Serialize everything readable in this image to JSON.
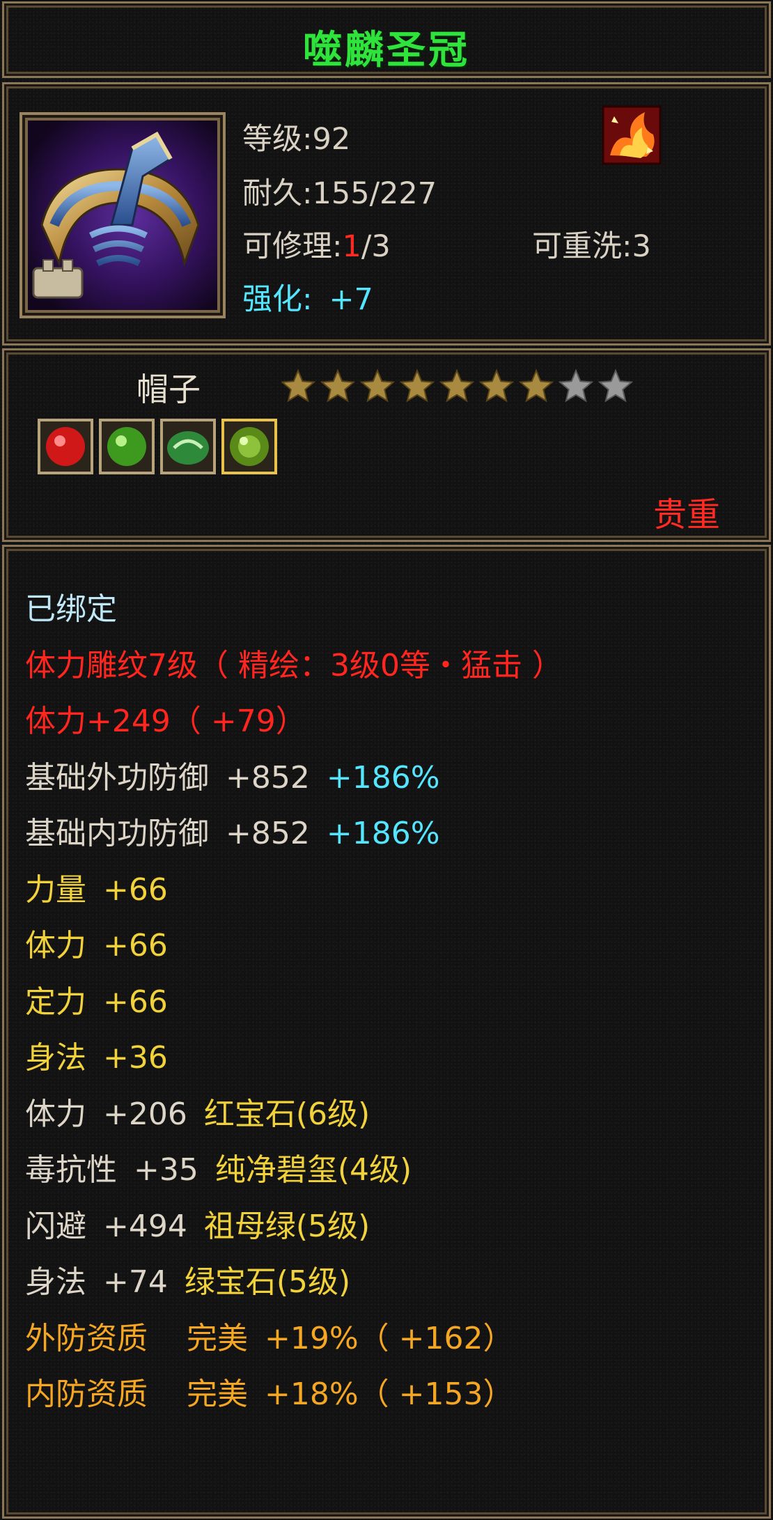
{
  "item": {
    "name": "噬麟圣冠",
    "level_label": "等级",
    "level": "92",
    "durability_label": "耐久",
    "durability": "155/227",
    "repair_label": "可修理",
    "repair_used": "1",
    "repair_total": "/3",
    "rewash_label": "可重洗",
    "rewash": "3",
    "enhance_label": "强化",
    "enhance": "+7",
    "slot": "帽子",
    "stars_filled": 7,
    "stars_total": 9,
    "rarity": "贵重",
    "gems": [
      "ruby-icon",
      "green-gem-icon",
      "jade-icon",
      "emerald-icon"
    ]
  },
  "attributes": {
    "bound": "已绑定",
    "engrave": "体力雕纹7级（ 精绘：3级0等・猛击 ）",
    "stamina_main": "体力+249（ +79）",
    "ext_def_name": "基础外功防御",
    "ext_def_val": "+852",
    "ext_def_pct": "+186%",
    "int_def_name": "基础内功防御",
    "int_def_val": "+852",
    "int_def_pct": "+186%",
    "str_name": "力量",
    "str_val": "+66",
    "sta_name": "体力",
    "sta_val": "+66",
    "foc_name": "定力",
    "foc_val": "+66",
    "agi_name": "身法",
    "agi_val": "+36",
    "gem1_stat": "体力",
    "gem1_val": "+206",
    "gem1_name": "红宝石(6级)",
    "gem2_stat": "毒抗性",
    "gem2_val": "+35",
    "gem2_name": "纯净碧玺(4级)",
    "gem3_stat": "闪避",
    "gem3_val": "+494",
    "gem3_name": "祖母绿(5级)",
    "gem4_stat": "身法",
    "gem4_val": "+74",
    "gem4_name": "绿宝石(5级)",
    "q1_name": "外防资质",
    "q1_grade": "完美",
    "q1_val": "+19%（ +162）",
    "q2_name": "内防资质",
    "q2_grade": "完美",
    "q2_val": "+18%（ +153）"
  },
  "colors": {
    "title": "#2fe33c",
    "red": "#ff2620",
    "yellow": "#f2d23a",
    "orange": "#f5a623",
    "cyan": "#55e6ff",
    "frame": "#8b7658"
  }
}
